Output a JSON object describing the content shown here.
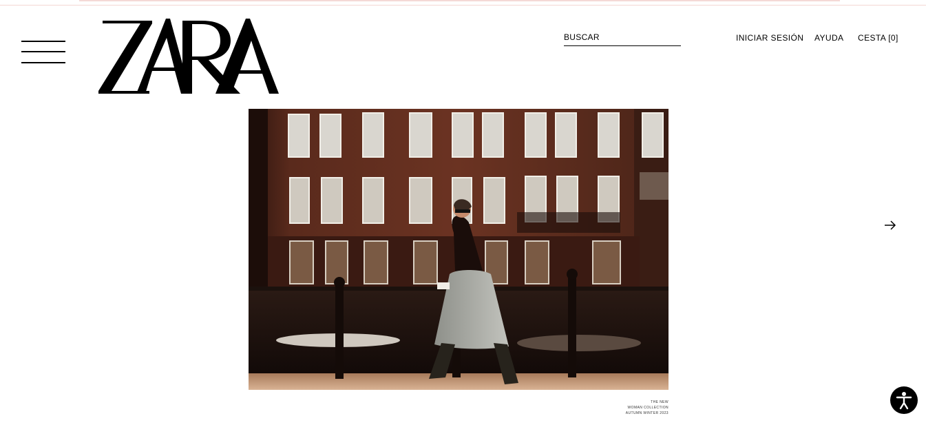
{
  "header": {
    "logo_text": "ZARA",
    "menu_icon": "hamburger-icon",
    "search": {
      "placeholder": "BUSCAR",
      "value": ""
    },
    "nav": {
      "login_label": "INICIAR SESIÓN",
      "help_label": "AYUDA",
      "cart_label": "CESTA [0]"
    }
  },
  "hero": {
    "caption_lines": [
      "THE NEW",
      "WOMAN COLLECTION",
      "AUTUMN WINTER 2023"
    ],
    "next_icon": "arrow-right-icon"
  },
  "accessibility": {
    "icon": "accessibility-icon"
  },
  "colors": {
    "text": "#000000",
    "background": "#ffffff",
    "top_strip": "#f5d9d6",
    "accessibility_button": "#000000"
  }
}
